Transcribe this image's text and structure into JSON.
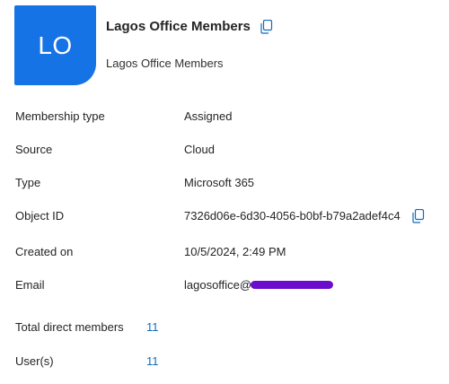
{
  "header": {
    "avatar_initials": "LO",
    "title": "Lagos Office Members",
    "subtitle": "Lagos Office Members",
    "copy_icon": "copy-icon"
  },
  "properties": [
    {
      "label": "Membership type",
      "value": "Assigned"
    },
    {
      "label": "Source",
      "value": "Cloud"
    },
    {
      "label": "Type",
      "value": "Microsoft 365"
    },
    {
      "label": "Object ID",
      "value": "7326d06e-6d30-4056-b0bf-b79a2adef4c4"
    },
    {
      "label": "Created on",
      "value": "10/5/2024, 2:49 PM"
    },
    {
      "label": "Email",
      "value": "lagosoffice@"
    }
  ],
  "members": [
    {
      "label": "Total direct members",
      "value": "11"
    },
    {
      "label": "User(s)",
      "value": "11"
    }
  ],
  "colors": {
    "avatar": "#1673e6",
    "link": "#0f6cbd",
    "redaction": "#6a0dcc"
  }
}
